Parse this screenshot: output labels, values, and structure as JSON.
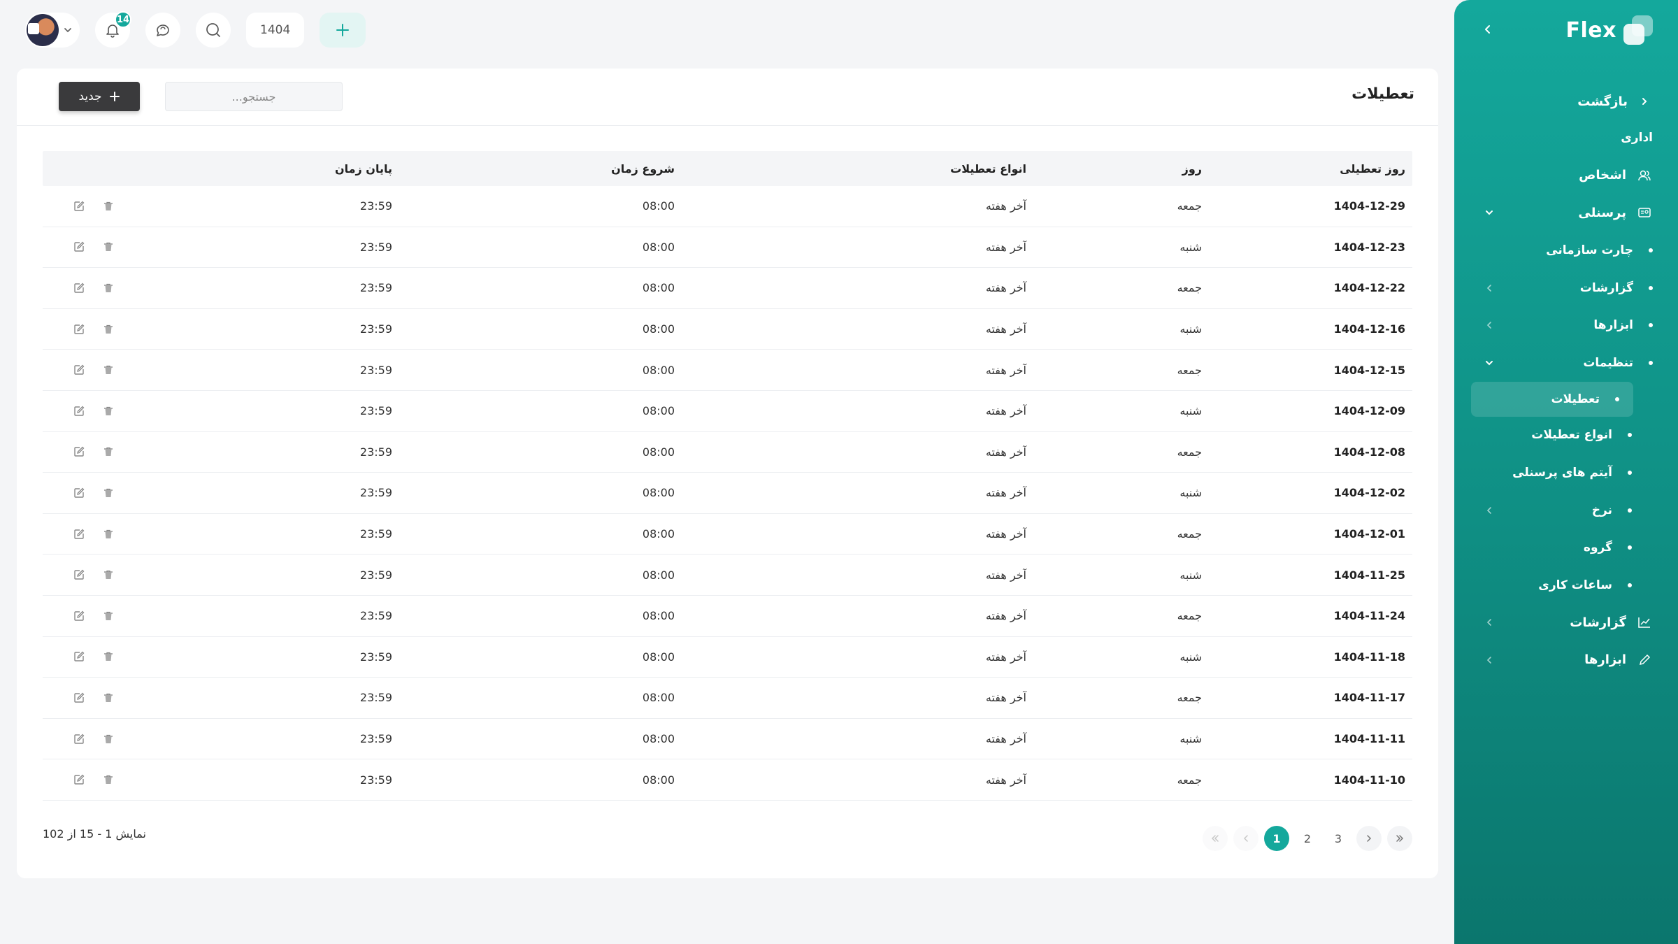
{
  "app": {
    "name": "Flex"
  },
  "colors": {
    "accent": "#14a89c",
    "accent_dark": "#0b766d",
    "button_dark": "#3a3a3c"
  },
  "topbar": {
    "notification_count": "14",
    "year": "1404",
    "icons": [
      "chevron-down-icon",
      "bell-icon",
      "chat-icon",
      "search-icon",
      "plus-icon"
    ]
  },
  "sidebar": {
    "back_label": "بازگشت",
    "section_label": "اداری",
    "items": [
      {
        "label": "اشخاص",
        "icon": "users-icon"
      },
      {
        "label": "پرسنلی",
        "icon": "id-card-icon",
        "expanded": true
      },
      {
        "label": "چارت سازمانی"
      },
      {
        "label": "گزارشات"
      },
      {
        "label": "ابزارها"
      },
      {
        "label": "تنظیمات",
        "expanded": true
      },
      {
        "label": "تعطیلات",
        "active": true
      },
      {
        "label": "انواع تعطیلات"
      },
      {
        "label": "آیتم های پرسنلی"
      },
      {
        "label": "نرخ"
      },
      {
        "label": "گروه"
      },
      {
        "label": "ساعات کاری"
      },
      {
        "label": "گزارشات",
        "icon": "chart-icon"
      },
      {
        "label": "ابزارها",
        "icon": "pencil-icon"
      }
    ]
  },
  "page": {
    "title": "تعطیلات",
    "search_placeholder": "جستجو...",
    "new_button": "جدید"
  },
  "table": {
    "columns": [
      "روز تعطیلی",
      "روز",
      "انواع تعطیلات",
      "شروع زمان",
      "پایان زمان"
    ],
    "rows": [
      [
        "1404-12-29",
        "جمعه",
        "آخر هفته",
        "08:00",
        "23:59"
      ],
      [
        "1404-12-23",
        "شنبه",
        "آخر هفته",
        "08:00",
        "23:59"
      ],
      [
        "1404-12-22",
        "جمعه",
        "آخر هفته",
        "08:00",
        "23:59"
      ],
      [
        "1404-12-16",
        "شنبه",
        "آخر هفته",
        "08:00",
        "23:59"
      ],
      [
        "1404-12-15",
        "جمعه",
        "آخر هفته",
        "08:00",
        "23:59"
      ],
      [
        "1404-12-09",
        "شنبه",
        "آخر هفته",
        "08:00",
        "23:59"
      ],
      [
        "1404-12-08",
        "جمعه",
        "آخر هفته",
        "08:00",
        "23:59"
      ],
      [
        "1404-12-02",
        "شنبه",
        "آخر هفته",
        "08:00",
        "23:59"
      ],
      [
        "1404-12-01",
        "جمعه",
        "آخر هفته",
        "08:00",
        "23:59"
      ],
      [
        "1404-11-25",
        "شنبه",
        "آخر هفته",
        "08:00",
        "23:59"
      ],
      [
        "1404-11-24",
        "جمعه",
        "آخر هفته",
        "08:00",
        "23:59"
      ],
      [
        "1404-11-18",
        "شنبه",
        "آخر هفته",
        "08:00",
        "23:59"
      ],
      [
        "1404-11-17",
        "جمعه",
        "آخر هفته",
        "08:00",
        "23:59"
      ],
      [
        "1404-11-11",
        "شنبه",
        "آخر هفته",
        "08:00",
        "23:59"
      ],
      [
        "1404-11-10",
        "جمعه",
        "آخر هفته",
        "08:00",
        "23:59"
      ]
    ],
    "row_action_icons": [
      "edit-icon",
      "trash-icon"
    ]
  },
  "footer": {
    "showing": "نمایش 1 - 15 از 102",
    "pages": [
      "1",
      "2",
      "3"
    ],
    "current_page": "1"
  }
}
